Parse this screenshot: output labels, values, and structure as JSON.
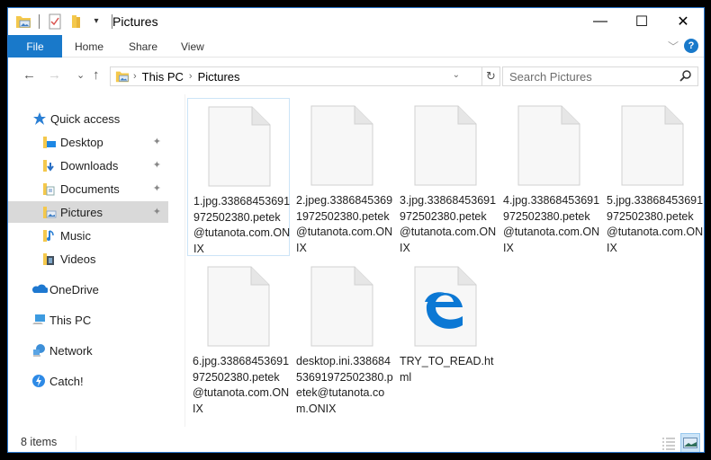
{
  "window": {
    "title": "Pictures",
    "controls": {
      "minimize": "—",
      "maximize": "☐",
      "close": "✕"
    }
  },
  "ribbon": {
    "tabs": [
      {
        "label": "File",
        "active": true
      },
      {
        "label": "Home"
      },
      {
        "label": "Share"
      },
      {
        "label": "View"
      }
    ],
    "expand_icon": "﹀",
    "help_label": "?"
  },
  "nav": {
    "back": "←",
    "forward": "→",
    "recent": "⌄",
    "up": "↑",
    "breadcrumb": [
      "This PC",
      "Pictures"
    ],
    "separator": "›",
    "dropdown": "⌄",
    "refresh": "↻",
    "search_placeholder": "Search Pictures"
  },
  "sidebar": {
    "items": [
      {
        "label": "Quick access",
        "icon": "star-icon",
        "pinned": false
      },
      {
        "label": "Desktop",
        "icon": "desktop-folder-icon",
        "pinned": true
      },
      {
        "label": "Downloads",
        "icon": "downloads-folder-icon",
        "pinned": true
      },
      {
        "label": "Documents",
        "icon": "documents-folder-icon",
        "pinned": true
      },
      {
        "label": "Pictures",
        "icon": "pictures-folder-icon",
        "pinned": true,
        "selected": true
      },
      {
        "label": "Music",
        "icon": "music-folder-icon",
        "pinned": false
      },
      {
        "label": "Videos",
        "icon": "videos-folder-icon",
        "pinned": false
      },
      {
        "label": "OneDrive",
        "icon": "onedrive-icon",
        "pinned": false
      },
      {
        "label": "This PC",
        "icon": "this-pc-icon",
        "pinned": false
      },
      {
        "label": "Network",
        "icon": "network-icon",
        "pinned": false
      },
      {
        "label": "Catch!",
        "icon": "catch-icon",
        "pinned": false
      }
    ],
    "pin_glyph": "📌"
  },
  "files": [
    {
      "name": "1.jpg.33868453691972502380.petek@tutanota.com.ONIX",
      "type": "blank-file"
    },
    {
      "name": "2.jpeg.33868453691972502380.petek@tutanota.com.ONIX",
      "type": "blank-file"
    },
    {
      "name": "3.jpg.33868453691972502380.petek@tutanota.com.ONIX",
      "type": "blank-file"
    },
    {
      "name": "4.jpg.33868453691972502380.petek@tutanota.com.ONIX",
      "type": "blank-file"
    },
    {
      "name": "5.jpg.33868453691972502380.petek@tutanota.com.ONIX",
      "type": "blank-file"
    },
    {
      "name": "6.jpg.33868453691972502380.petek@tutanota.com.ONIX",
      "type": "blank-file"
    },
    {
      "name": "desktop.ini.33868453691972502380.petek@tutanota.com.ONIX",
      "type": "blank-file"
    },
    {
      "name": "TRY_TO_READ.html",
      "type": "edge-html-file"
    }
  ],
  "status": {
    "item_count": "8 items"
  },
  "colors": {
    "accent": "#1979ca",
    "selection": "#d9d9d9",
    "edge_blue": "#0c78d4",
    "folder_yellow": "#f4c84c"
  }
}
